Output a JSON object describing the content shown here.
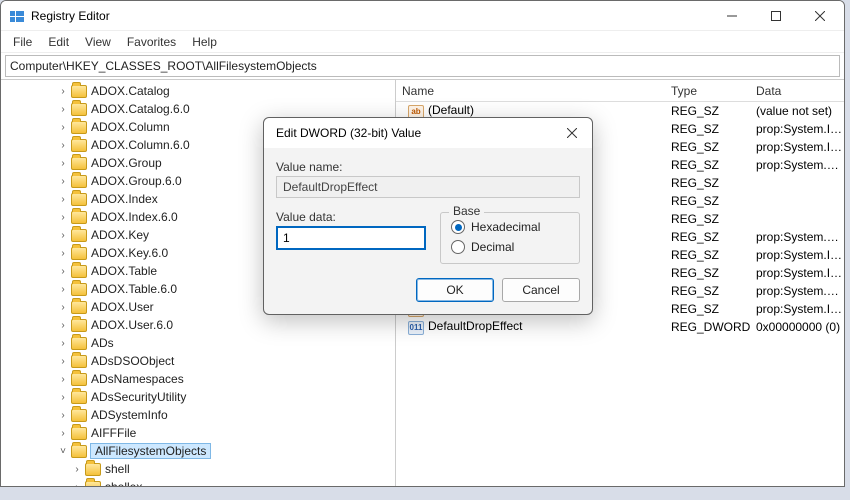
{
  "window": {
    "title": "Registry Editor"
  },
  "menu": [
    "File",
    "Edit",
    "View",
    "Favorites",
    "Help"
  ],
  "address": "Computer\\HKEY_CLASSES_ROOT\\AllFilesystemObjects",
  "tree": [
    {
      "label": "ADOX.Catalog",
      "indent": 4,
      "expand": ">"
    },
    {
      "label": "ADOX.Catalog.6.0",
      "indent": 4,
      "expand": ">"
    },
    {
      "label": "ADOX.Column",
      "indent": 4,
      "expand": ">"
    },
    {
      "label": "ADOX.Column.6.0",
      "indent": 4,
      "expand": ">"
    },
    {
      "label": "ADOX.Group",
      "indent": 4,
      "expand": ">"
    },
    {
      "label": "ADOX.Group.6.0",
      "indent": 4,
      "expand": ">"
    },
    {
      "label": "ADOX.Index",
      "indent": 4,
      "expand": ">"
    },
    {
      "label": "ADOX.Index.6.0",
      "indent": 4,
      "expand": ">"
    },
    {
      "label": "ADOX.Key",
      "indent": 4,
      "expand": ">"
    },
    {
      "label": "ADOX.Key.6.0",
      "indent": 4,
      "expand": ">"
    },
    {
      "label": "ADOX.Table",
      "indent": 4,
      "expand": ">"
    },
    {
      "label": "ADOX.Table.6.0",
      "indent": 4,
      "expand": ">"
    },
    {
      "label": "ADOX.User",
      "indent": 4,
      "expand": ">"
    },
    {
      "label": "ADOX.User.6.0",
      "indent": 4,
      "expand": ">"
    },
    {
      "label": "ADs",
      "indent": 4,
      "expand": ">"
    },
    {
      "label": "ADsDSOObject",
      "indent": 4,
      "expand": ">"
    },
    {
      "label": "ADsNamespaces",
      "indent": 4,
      "expand": ">"
    },
    {
      "label": "ADsSecurityUtility",
      "indent": 4,
      "expand": ">"
    },
    {
      "label": "ADSystemInfo",
      "indent": 4,
      "expand": ">"
    },
    {
      "label": "AIFFFile",
      "indent": 4,
      "expand": ">"
    },
    {
      "label": "AllFilesystemObjects",
      "indent": 4,
      "expand": "v",
      "selected": true
    },
    {
      "label": "shell",
      "indent": 5,
      "expand": ">"
    },
    {
      "label": "shellex",
      "indent": 5,
      "expand": ">"
    }
  ],
  "list": {
    "headers": {
      "name": "Name",
      "type": "Type",
      "data": "Data"
    },
    "rows": [
      {
        "icon": "sz",
        "name": "(Default)",
        "type": "REG_SZ",
        "data": "(value not set)"
      },
      {
        "icon": "sz",
        "name": "",
        "type": "REG_SZ",
        "data": "prop:System.Item..."
      },
      {
        "icon": "sz",
        "name": "",
        "type": "REG_SZ",
        "data": "prop:System.Item..."
      },
      {
        "icon": "sz",
        "name": "",
        "type": "REG_SZ",
        "data": "prop:System.Prop..."
      },
      {
        "icon": "sz",
        "name": "",
        "type": "REG_SZ",
        "data": ""
      },
      {
        "icon": "sz",
        "name": "",
        "type": "REG_SZ",
        "data": ""
      },
      {
        "icon": "sz",
        "name": "",
        "type": "REG_SZ",
        "data": ""
      },
      {
        "icon": "sz",
        "name": "",
        "type": "REG_SZ",
        "data": "prop:System.Date..."
      },
      {
        "icon": "sz",
        "name": "",
        "type": "REG_SZ",
        "data": "prop:System.Item..."
      },
      {
        "icon": "sz",
        "name": "",
        "type": "REG_SZ",
        "data": "prop:System.ItemE..."
      },
      {
        "icon": "sz",
        "name": "",
        "type": "REG_SZ",
        "data": "prop:System.Auth..."
      },
      {
        "icon": "sz",
        "name": "",
        "type": "REG_SZ",
        "data": "prop:System.Item..."
      },
      {
        "icon": "bin",
        "name": "DefaultDropEffect",
        "type": "REG_DWORD",
        "data": "0x00000000 (0)"
      }
    ]
  },
  "dialog": {
    "title": "Edit DWORD (32-bit) Value",
    "value_name_label": "Value name:",
    "value_name": "DefaultDropEffect",
    "value_data_label": "Value data:",
    "value_data": "1",
    "base_label": "Base",
    "hex_label": "Hexadecimal",
    "dec_label": "Decimal",
    "base_selected": "hex",
    "ok": "OK",
    "cancel": "Cancel"
  }
}
